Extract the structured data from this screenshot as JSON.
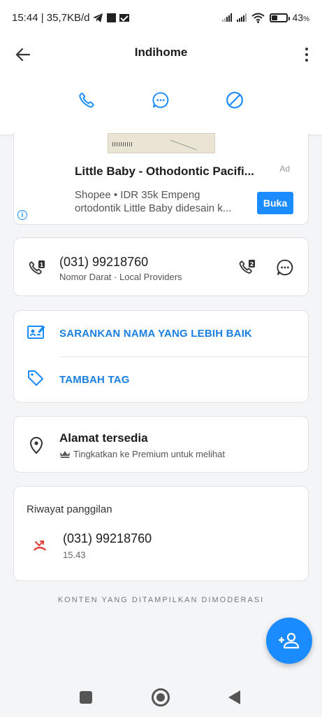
{
  "status_bar": {
    "time_speed": "15:44 | 35,7KB/d",
    "battery_level": 0.43,
    "battery_percent": "43",
    "battery_unit": "%"
  },
  "app_bar": {
    "title": "Indihome"
  },
  "ad": {
    "title": "Little Baby - Othodontic Pacifi...",
    "tag": "Ad",
    "description_line1": "Shopee • IDR 35k Empeng",
    "description_line2": "ortodontik Little Baby didesain k...",
    "button_label": "Buka",
    "info_glyph": "i"
  },
  "number": {
    "value": "(031) 99218760",
    "subtitle": "Nomor Darat · Local Providers"
  },
  "suggestions": {
    "suggest_name": "SARANKAN NAMA YANG LEBIH BAIK",
    "add_tag": "TAMBAH TAG"
  },
  "address": {
    "title": "Alamat tersedia",
    "subtitle": "Tingkatkan ke Premium untuk melihat"
  },
  "history": {
    "title": "Riwayat panggilan",
    "items": [
      {
        "number": "(031) 99218760",
        "time": "15.43"
      }
    ]
  },
  "footer_note": "KONTEN YANG DITAMPILKAN DIMODERASI",
  "colors": {
    "accent": "#1a8cff",
    "link": "#1a7fe0",
    "missed_call": "#e53935"
  },
  "icons": {
    "back": "arrow-left-icon",
    "more": "more-vertical-icon",
    "call": "phone-icon",
    "message": "chat-bubble-icon",
    "block": "block-icon",
    "sim1": "phone-sim1-icon",
    "sim2": "phone-sim2-icon",
    "suggest": "edit-contact-card-icon",
    "tag": "tag-icon",
    "location": "location-pin-icon",
    "crown": "crown-icon",
    "missed": "missed-call-icon",
    "add_contact": "add-contact-icon"
  }
}
